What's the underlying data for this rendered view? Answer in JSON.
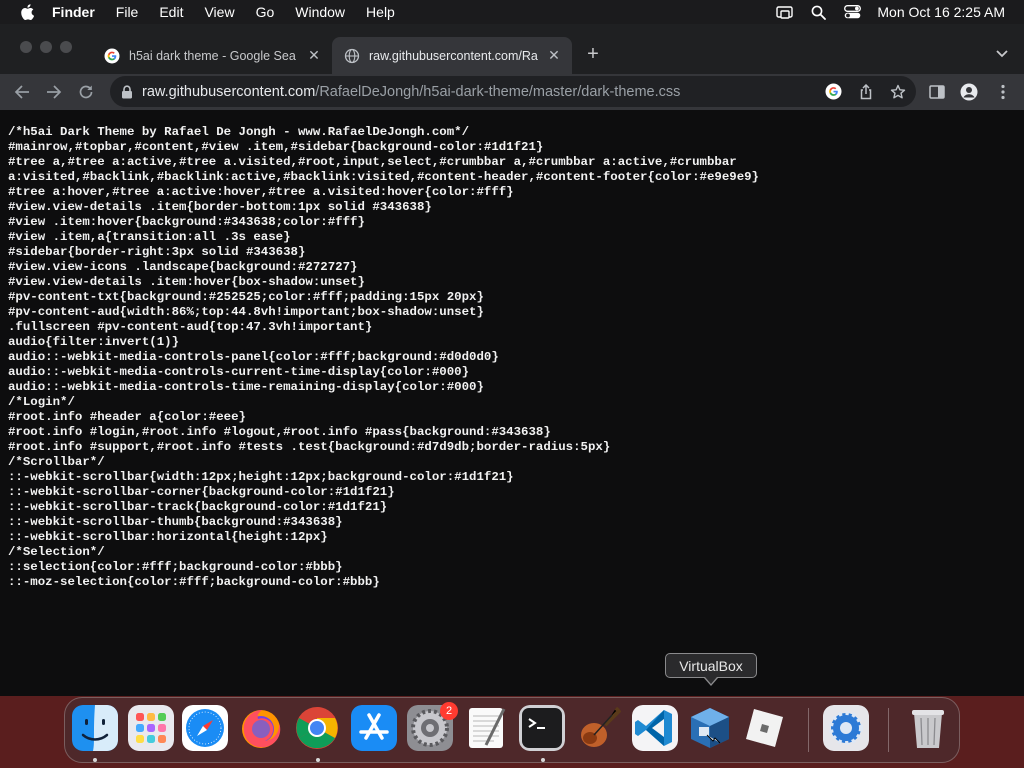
{
  "menubar": {
    "app_name": "Finder",
    "items": [
      "File",
      "Edit",
      "View",
      "Go",
      "Window",
      "Help"
    ],
    "clock": "Mon Oct 16  2:25 AM",
    "status_icons": [
      "screen-mirroring-icon",
      "spotlight-search-icon",
      "control-center-icon"
    ]
  },
  "browser": {
    "tabs": [
      {
        "title": "h5ai dark theme - Google Sea",
        "icon": "google-icon",
        "active": false
      },
      {
        "title": "raw.githubusercontent.com/Ra",
        "icon": "globe-icon",
        "active": true
      }
    ],
    "url": {
      "host": "raw.githubusercontent.com",
      "path": "/RafaelDeJongh/h5ai-dark-theme/master/dark-theme.css"
    },
    "page_lines": [
      "/*h5ai Dark Theme by Rafael De Jongh - www.RafaelDeJongh.com*/",
      "#mainrow,#topbar,#content,#view .item,#sidebar{background-color:#1d1f21}",
      "#tree a,#tree a:active,#tree a.visited,#root,input,select,#crumbbar a,#crumbbar a:active,#crumbbar",
      "a:visited,#backlink,#backlink:active,#backlink:visited,#content-header,#content-footer{color:#e9e9e9}",
      "#tree a:hover,#tree a:active:hover,#tree a.visited:hover{color:#fff}",
      "#view.view-details .item{border-bottom:1px solid #343638}",
      "#view .item:hover{background:#343638;color:#fff}",
      "#view .item,a{transition:all .3s ease}",
      "#sidebar{border-right:3px solid #343638}",
      "#view.view-icons .landscape{background:#272727}",
      "#view.view-details .item:hover{box-shadow:unset}",
      "#pv-content-txt{background:#252525;color:#fff;padding:15px 20px}",
      "#pv-content-aud{width:86%;top:44.8vh!important;box-shadow:unset}",
      ".fullscreen #pv-content-aud{top:47.3vh!important}",
      "audio{filter:invert(1)}",
      "audio::-webkit-media-controls-panel{color:#fff;background:#d0d0d0}",
      "audio::-webkit-media-controls-current-time-display{color:#000}",
      "audio::-webkit-media-controls-time-remaining-display{color:#000}",
      "/*Login*/",
      "#root.info #header a{color:#eee}",
      "#root.info #login,#root.info #logout,#root.info #pass{background:#343638}",
      "#root.info #support,#root.info #tests .test{background:#d7d9db;border-radius:5px}",
      "/*Scrollbar*/",
      "::-webkit-scrollbar{width:12px;height:12px;background-color:#1d1f21}",
      "::-webkit-scrollbar-corner{background-color:#1d1f21}",
      "::-webkit-scrollbar-track{background-color:#1d1f21}",
      "::-webkit-scrollbar-thumb{background:#343638}",
      "::-webkit-scrollbar:horizontal{height:12px}",
      "/*Selection*/",
      "::selection{color:#fff;background-color:#bbb}",
      "::-moz-selection{color:#fff;background-color:#bbb}"
    ]
  },
  "tooltip": {
    "text": "VirtualBox"
  },
  "dock": {
    "items": [
      {
        "name": "finder",
        "running": true
      },
      {
        "name": "launchpad",
        "running": false
      },
      {
        "name": "safari",
        "running": false
      },
      {
        "name": "firefox",
        "running": false
      },
      {
        "name": "chrome",
        "running": true
      },
      {
        "name": "app-store",
        "running": false
      },
      {
        "name": "system-preferences",
        "running": false,
        "badge": "2"
      },
      {
        "name": "textedit",
        "running": false
      },
      {
        "name": "terminal",
        "running": true
      },
      {
        "name": "garageband",
        "running": false
      },
      {
        "name": "vscode",
        "running": false
      },
      {
        "name": "virtualbox",
        "running": false
      },
      {
        "name": "roblox",
        "running": false
      },
      {
        "name": "settings-utility",
        "running": false
      },
      {
        "name": "trash",
        "running": false
      }
    ]
  },
  "colors": {
    "menubar_bg": "#1b1b1d",
    "tabstrip_bg": "#1f2022",
    "toolbar_bg": "#35363a",
    "page_bg": "#0d0d0e",
    "wallpaper": "#5a1e1e",
    "badge": "#ff3b30"
  }
}
